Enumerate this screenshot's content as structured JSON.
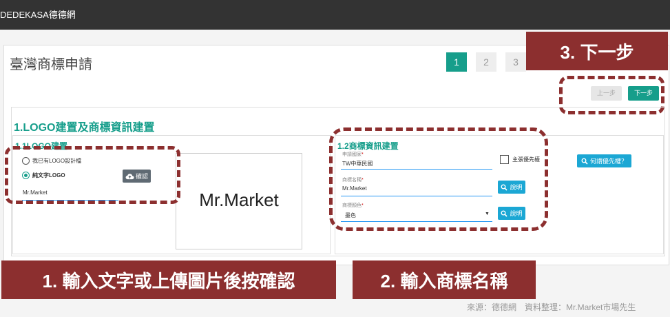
{
  "app": {
    "brand": "DEDEKASA德德網"
  },
  "page": {
    "title": "臺灣商標申請"
  },
  "steps": [
    "1",
    "2",
    "3"
  ],
  "nav": {
    "prev_label": "上一步",
    "next_label": "下一步"
  },
  "section": {
    "title": "1.LOGO建置及商標資訊建置",
    "logo": {
      "title": "1.1LOGO建置",
      "option_design": "我已有LOGO設計檔",
      "option_text": "純文字LOGO",
      "text_value": "Mr.Market",
      "confirm_label": "確認",
      "preview_text": "Mr.Market"
    },
    "info": {
      "title": "1.2商標資訊建置",
      "country_label": "申請國家",
      "country_value": "TW中華民國",
      "priority_label": "主張優先權",
      "priority_button": "何謂優先權？",
      "name_label": "商標名稱",
      "name_value": "Mr.Market",
      "explain_label": "說明",
      "color_label": "商標顏色",
      "color_value": "墨色"
    },
    "required_mark": "*"
  },
  "annotations": {
    "step3": "3. 下一步",
    "step1": "1. 輸入文字或上傳圖片後按確認",
    "step2": "2. 輸入商標名稱"
  },
  "source": "來源：德德網　資料整理：Mr.Market市場先生",
  "colors": {
    "accent": "#169e8b",
    "annotation": "#8c2f2f",
    "info_button": "#1ba7d4"
  },
  "icons": [
    "cloud-upload-icon",
    "search-icon",
    "dropdown-arrow-icon"
  ]
}
